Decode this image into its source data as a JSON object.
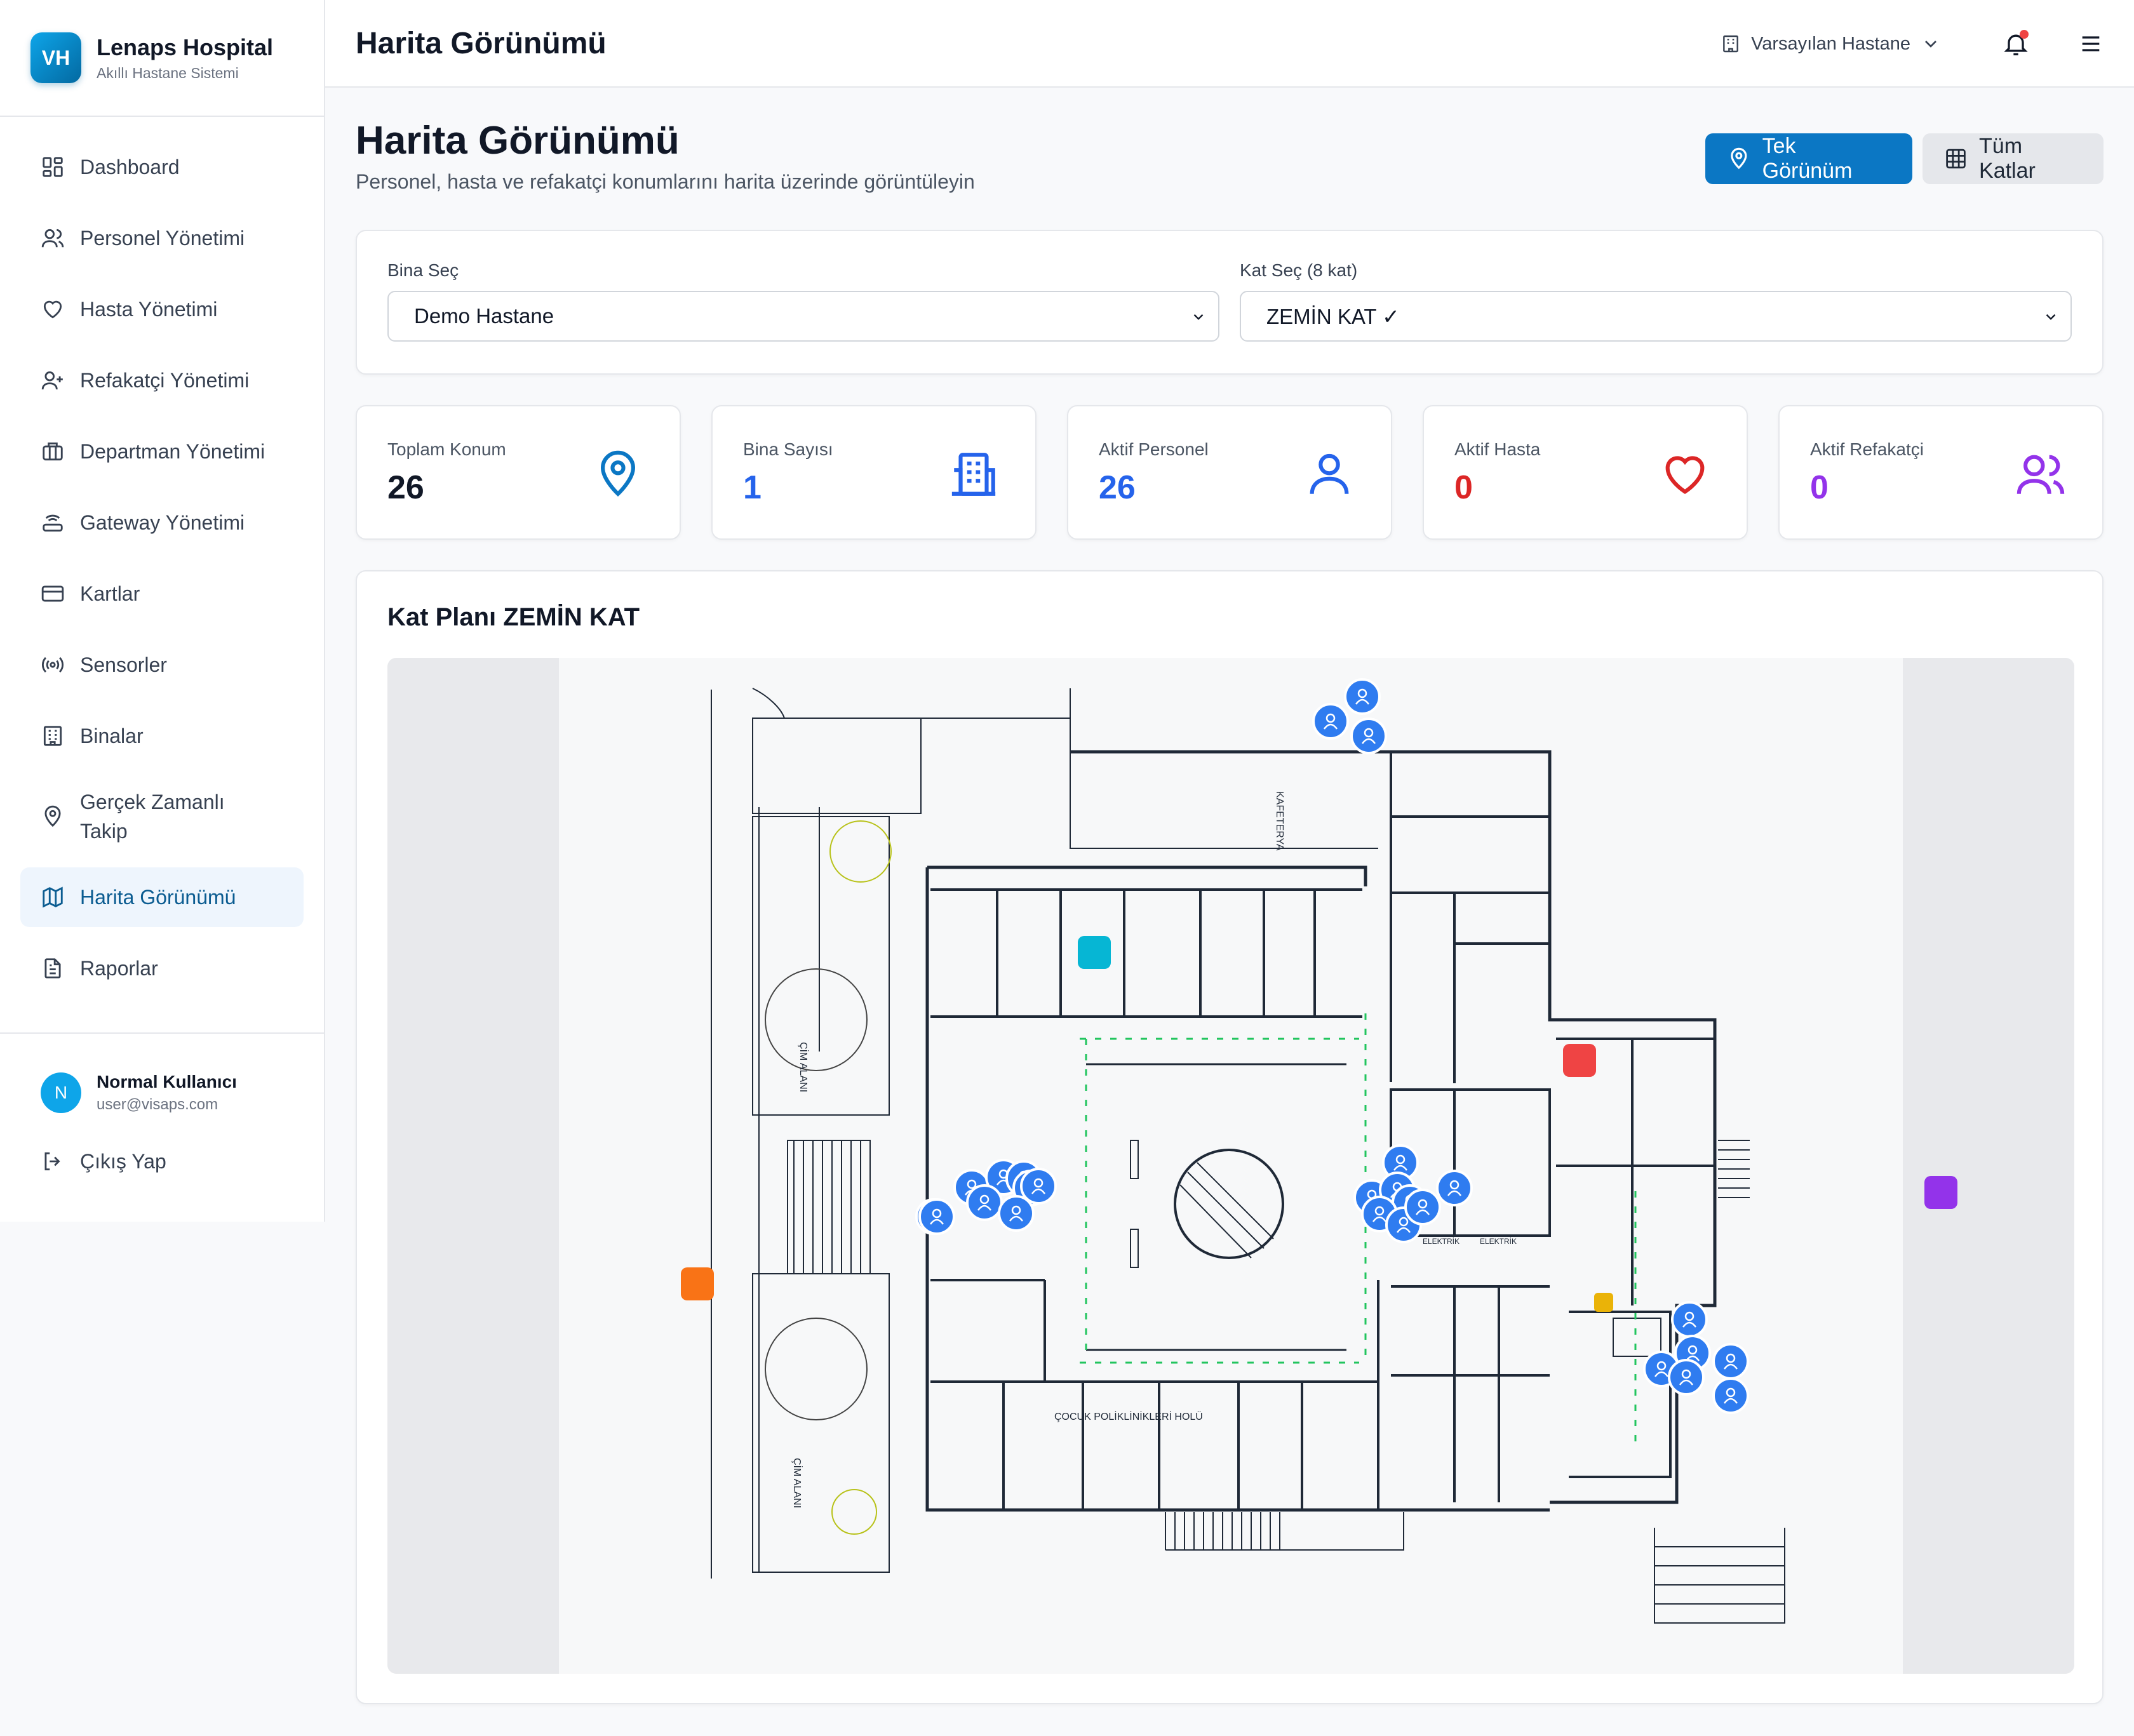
{
  "brand": {
    "logo": "VH",
    "title": "Lenaps Hospital",
    "subtitle": "Akıllı Hastane Sistemi"
  },
  "nav": [
    {
      "label": "Dashboard",
      "icon": "dashboard-icon"
    },
    {
      "label": "Personel Yönetimi",
      "icon": "users-icon"
    },
    {
      "label": "Hasta Yönetimi",
      "icon": "heart-icon"
    },
    {
      "label": "Refakatçi Yönetimi",
      "icon": "user-plus-icon"
    },
    {
      "label": "Departman Yönetimi",
      "icon": "briefcase-icon"
    },
    {
      "label": "Gateway Yönetimi",
      "icon": "router-icon"
    },
    {
      "label": "Kartlar",
      "icon": "card-icon"
    },
    {
      "label": "Sensorler",
      "icon": "radio-icon"
    },
    {
      "label": "Binalar",
      "icon": "building-icon"
    },
    {
      "label": "Gerçek Zamanlı Takip",
      "icon": "map-pin-icon"
    },
    {
      "label": "Harita Görünümü",
      "icon": "map-icon",
      "active": true
    },
    {
      "label": "Raporlar",
      "icon": "report-icon"
    }
  ],
  "user": {
    "initial": "N",
    "name": "Normal Kullanıcı",
    "email": "user@visaps.com"
  },
  "logout_label": "Çıkış Yap",
  "topbar": {
    "title": "Harita Görünümü",
    "hospital_select": "Varsayılan Hastane"
  },
  "page": {
    "title": "Harita Görünümü",
    "subtitle": "Personel, hasta ve refakatçi konumlarını harita üzerinde görüntüleyin",
    "btn_single": "Tek Görünüm",
    "btn_all": "Tüm Katlar"
  },
  "filters": {
    "building_label": "Bina Seç",
    "building_value": "Demo Hastane",
    "floor_label": "Kat Seç (8 kat)",
    "floor_value": "ZEMİN KAT ✓"
  },
  "stats": [
    {
      "label": "Toplam Konum",
      "value": "26",
      "color": "#111827",
      "icon_color": "#0b77c4",
      "icon": "map-pin-icon"
    },
    {
      "label": "Bina Sayısı",
      "value": "1",
      "color": "#2563eb",
      "icon_color": "#2563eb",
      "icon": "building-icon"
    },
    {
      "label": "Aktif Personel",
      "value": "26",
      "color": "#2563eb",
      "icon_color": "#2563eb",
      "icon": "user-icon"
    },
    {
      "label": "Aktif Hasta",
      "value": "0",
      "color": "#dc2626",
      "icon_color": "#dc2626",
      "icon": "heart-icon"
    },
    {
      "label": "Aktif Refakatçi",
      "value": "0",
      "color": "#9333ea",
      "icon_color": "#9333ea",
      "icon": "users-icon"
    }
  ],
  "map": {
    "title": "Kat Planı ZEMİN KAT",
    "plan_labels": [
      "KAFETERYA",
      "ÇİM ALANI",
      "ÇİM ALANI",
      "ÇOCUK POLİKLİNİKLERİ HOLÜ",
      "ELEKTRİK",
      "ELEKTRİK"
    ],
    "personnel_count": 26
  }
}
